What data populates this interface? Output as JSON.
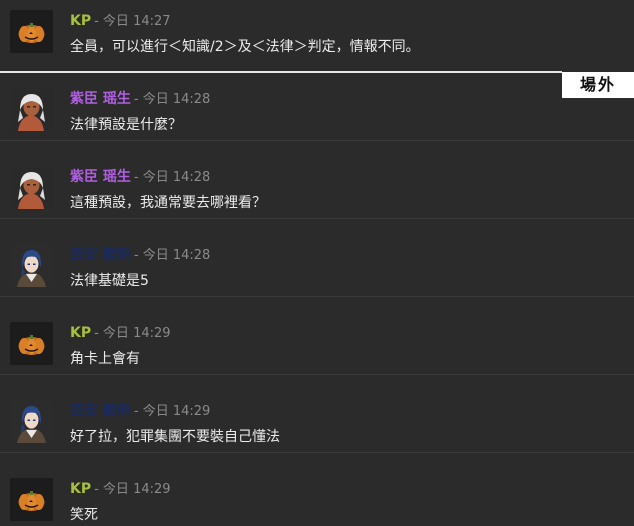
{
  "ooc_label": "場外",
  "messages": [
    {
      "speaker": "KP",
      "meta": "- 今日 14:27",
      "text": "全員，可以進行＜知識/2＞及＜法律＞判定，情報不同。",
      "avatar": "pumpkin-icon"
    },
    {
      "speaker": "紫臣 瑶生",
      "meta": "- 今日 14:28",
      "text": "法律預設是什麼？",
      "avatar": "white-hair-character-icon"
    },
    {
      "speaker": "紫臣 瑶生",
      "meta": "- 今日 14:28",
      "text": "這種預設，我通常要去哪裡看？",
      "avatar": "white-hair-character-icon"
    },
    {
      "speaker": "西安 韜明",
      "meta": "- 今日 14:28",
      "text": "法律基礎是5",
      "avatar": "blue-hair-character-icon"
    },
    {
      "speaker": "KP",
      "meta": "- 今日 14:29",
      "text": "角卡上會有",
      "avatar": "pumpkin-icon"
    },
    {
      "speaker": "西安 韜明",
      "meta": "- 今日 14:29",
      "text": "好了拉，犯罪集團不要裝自己懂法",
      "avatar": "blue-hair-character-icon"
    },
    {
      "speaker": "KP",
      "meta": "- 今日 14:29",
      "text": "笑死",
      "avatar": "pumpkin-icon"
    }
  ],
  "colors": {
    "background": "#2b2b2b",
    "kp_name": "#a7c13e",
    "purple_name": "#b05fe0",
    "navy_name": "#1a2a5c",
    "meta": "#8a8a8a",
    "text": "#ececec"
  }
}
